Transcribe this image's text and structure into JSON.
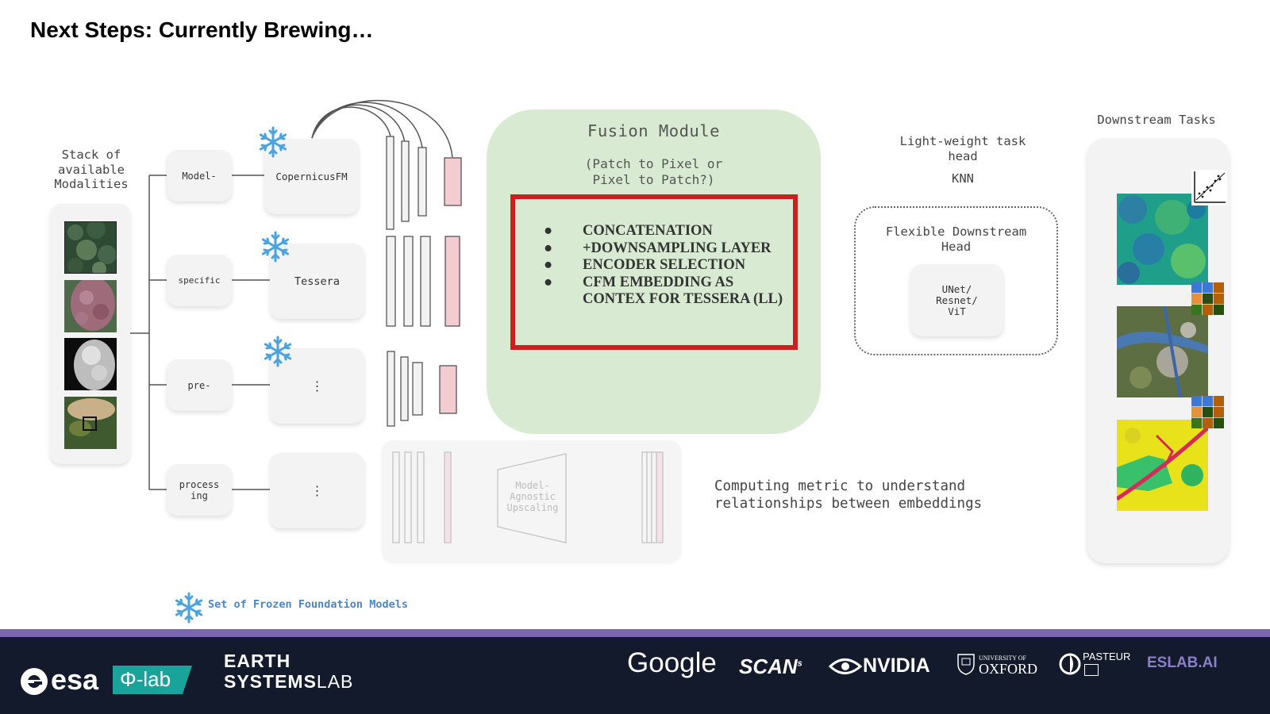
{
  "title": "Next Steps: Currently Brewing…",
  "stack_label": "Stack of available Modalities",
  "modalities": [
    "forest-rgb-thumbnail",
    "forest-falsecolor-thumbnail",
    "cloud-mask-thumbnail",
    "field-patch-thumbnail"
  ],
  "preprocessing": [
    "Model-",
    "specific",
    "pre-",
    "process ing"
  ],
  "foundation_models": [
    "CopernicusFM",
    "Tessera",
    "⋮",
    "⋮"
  ],
  "fusion": {
    "title": "Fusion Module",
    "subtitle_line1": "(Patch to Pixel or",
    "subtitle_line2": "Pixel to Patch?)",
    "bullets": [
      "CONCATENATION",
      "+DOWNSAMPLING LAYER",
      "ENCODER SELECTION",
      "CFM EMBEDDING AS CONTEX FOR TESSERA (LL)"
    ],
    "bullet_glyph": "●"
  },
  "upscaling_label": "Model- Agnostic Upscaling",
  "task_head": {
    "line1": "Light-weight task",
    "line2": "head",
    "method": "KNN"
  },
  "flexible_head": {
    "line1": "Flexible Downstream",
    "line2": "Head",
    "models": [
      "UNet/",
      "Resnet/",
      "ViT"
    ]
  },
  "compute_line1": "Computing metric to understand",
  "compute_line2": "relationships between embeddings",
  "downstream_label": "Downstream Tasks",
  "legend": "Set of Frozen Foundation Models",
  "icons": [
    "snowflake-icon",
    "scatter-plot-icon",
    "confusion-matrix-icon"
  ],
  "colors": {
    "fusion_bg": "#d9ead3",
    "red_box": "#cc1f1f",
    "snowflake": "#4aa3df",
    "pink_bar": "#f2ccd0",
    "footer_bg": "#131a2c",
    "footer_stripe": "#7a67b0",
    "eslab": "#8b7fc7"
  },
  "footer": {
    "esa": "esa",
    "philab": "Φ-lab",
    "earth": "EARTH",
    "systems": "SYSTEMS",
    "lab": "LAB",
    "google": "Google",
    "scan": "SCAN",
    "nvidia": "NVIDIA",
    "oxford_small": "UNIVERSITY OF",
    "oxford": "OXFORD",
    "pasteur": "PASTEUR",
    "eslab": "ESLAB.AI"
  }
}
